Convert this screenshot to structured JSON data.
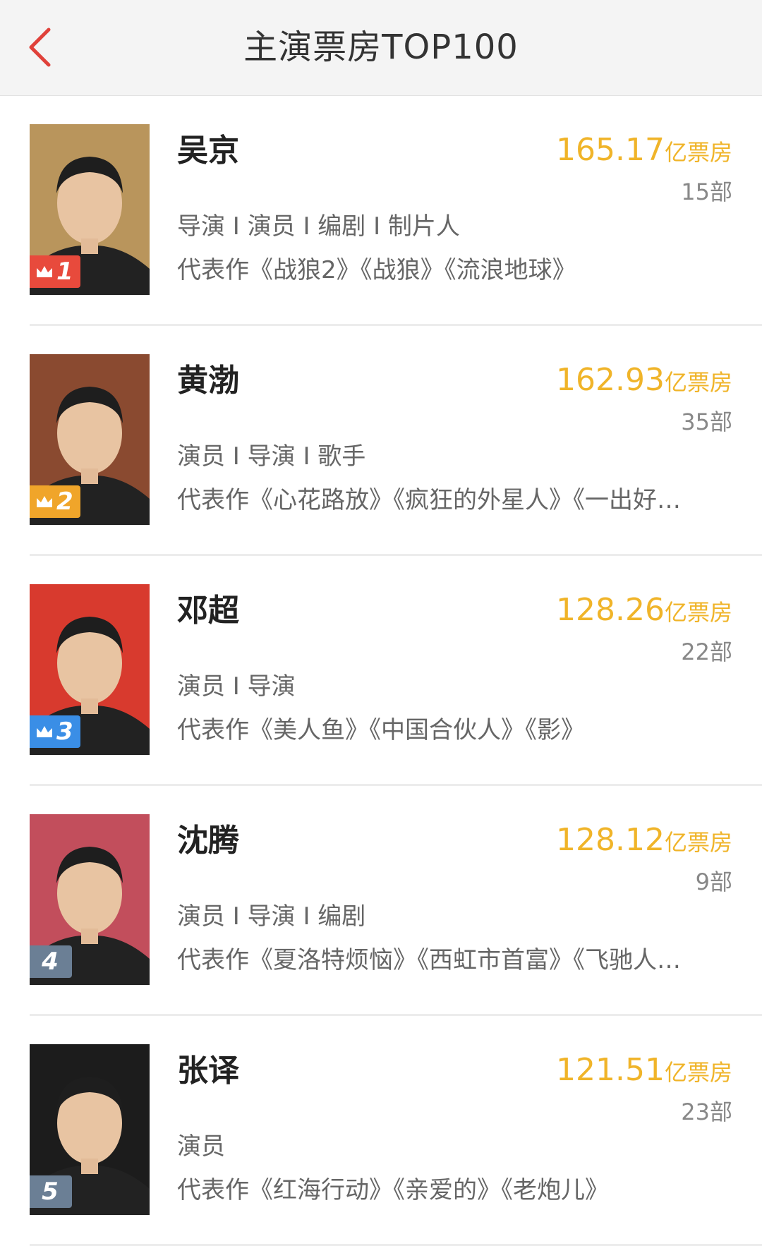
{
  "header": {
    "title": "主演票房TOP100"
  },
  "actors": [
    {
      "rank": "1",
      "name": "吴京",
      "box_num": "165.17",
      "box_unit": "亿票房",
      "count": "15部",
      "roles": "导演 I 演员 I 编剧 I 制片人",
      "works": "代表作《战狼2》《战狼》《流浪地球》",
      "badge_color": "#e84a3c",
      "bg_color": "#b9955c"
    },
    {
      "rank": "2",
      "name": "黄渤",
      "box_num": "162.93",
      "box_unit": "亿票房",
      "count": "35部",
      "roles": "演员 I 导演 I 歌手",
      "works": "代表作《心花路放》《疯狂的外星人》《一出好…",
      "badge_color": "#f0a52a",
      "bg_color": "#8a4a30"
    },
    {
      "rank": "3",
      "name": "邓超",
      "box_num": "128.26",
      "box_unit": "亿票房",
      "count": "22部",
      "roles": "演员 I 导演",
      "works": "代表作《美人鱼》《中国合伙人》《影》",
      "badge_color": "#3a8ee6",
      "bg_color": "#d83a2e"
    },
    {
      "rank": "4",
      "name": "沈腾",
      "box_num": "128.12",
      "box_unit": "亿票房",
      "count": "9部",
      "roles": "演员 I 导演 I 编剧",
      "works": "代表作《夏洛特烦恼》《西虹市首富》《飞驰人…",
      "badge_color": "#6b7f95",
      "bg_color": "#c24e5c"
    },
    {
      "rank": "5",
      "name": "张译",
      "box_num": "121.51",
      "box_unit": "亿票房",
      "count": "23部",
      "roles": "演员",
      "works": "代表作《红海行动》《亲爱的》《老炮儿》",
      "badge_color": "#6b7f95",
      "bg_color": "#1c1c1c"
    }
  ]
}
